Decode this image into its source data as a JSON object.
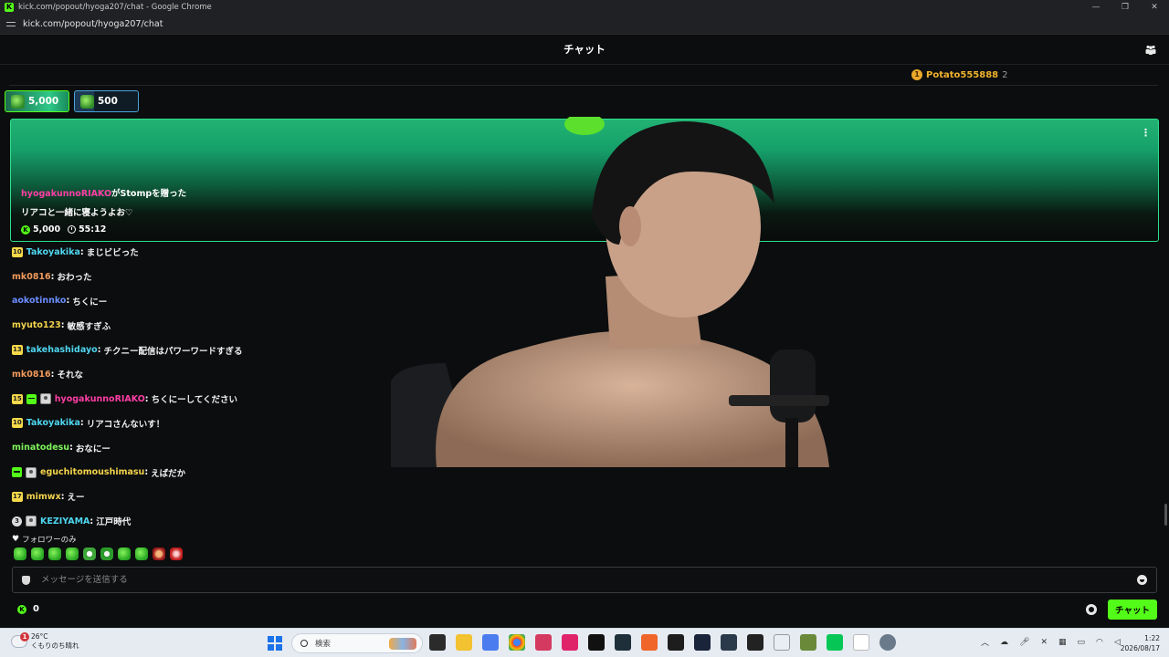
{
  "window": {
    "title": "kick.com/popout/hyoga207/chat - Google Chrome",
    "url": "kick.com/popout/hyoga207/chat"
  },
  "header": {
    "title": "チャット",
    "pinned_user": "Potato555888",
    "pinned_count": "2"
  },
  "gift_pills": [
    {
      "amount": "5,000"
    },
    {
      "amount": "500"
    }
  ],
  "gift_card": {
    "username": "hyogakunnoRIAKO",
    "action": "がStompを贈った",
    "message": "リアコと一緒に寝ようよお♡",
    "amount": "5,000",
    "timer": "55:12"
  },
  "messages": [
    {
      "badges": [
        "10"
      ],
      "user": "Takoyakika",
      "color": "#4fd6f0",
      "text": "まじビビった"
    },
    {
      "badges": [],
      "user": "mk0816",
      "color": "#f29a5c",
      "text": "おわった"
    },
    {
      "badges": [],
      "user": "aokotinnko",
      "color": "#6b8cff",
      "text": "ちくにー"
    },
    {
      "badges": [],
      "user": "myuto123",
      "color": "#f3d34c",
      "text": "敏感すぎふ"
    },
    {
      "badges": [
        "13"
      ],
      "user": "takehashidayo",
      "color": "#4fd6f0",
      "text": "チクニー配信はパワーワードすぎる"
    },
    {
      "badges": [],
      "user": "mk0816",
      "color": "#f29a5c",
      "text": "それな"
    },
    {
      "badges": [
        "15",
        "gift",
        "avatar"
      ],
      "user": "hyogakunnoRIAKO",
      "color": "#ff3ea5",
      "text": "ちくにーしてください"
    },
    {
      "badges": [
        "10"
      ],
      "user": "Takoyakika",
      "color": "#4fd6f0",
      "text": "リアコさんないす！"
    },
    {
      "badges": [],
      "user": "minatodesu",
      "color": "#7ef25a",
      "text": "おなにー"
    },
    {
      "badges": [
        "gift",
        "avatar"
      ],
      "user": "eguchitomoushimasu",
      "color": "#f3d34c",
      "text": "えばだか"
    },
    {
      "badges": [
        "17"
      ],
      "user": "mimwx",
      "color": "#f3d34c",
      "text": "えー"
    },
    {
      "badges": [
        "round:3",
        "avatar"
      ],
      "user": "KEZIYAMA",
      "color": "#4fd6f0",
      "text": "江戸時代"
    }
  ],
  "followers_only_label": "フォロワーのみ",
  "emotes_count": 10,
  "input": {
    "placeholder": "メッセージを送信する"
  },
  "bottom": {
    "points": "0",
    "send_label": "チャット"
  },
  "taskbar": {
    "weather_badge": "1",
    "temperature": "26°C",
    "weather": "くもりのち晴れ",
    "search_placeholder": "検索",
    "time": "1:22",
    "date": "2026/08/17"
  },
  "colors": {
    "kick_green": "#53fc18",
    "gift_border": "#2fe08b",
    "background": "#0b0d0e"
  }
}
